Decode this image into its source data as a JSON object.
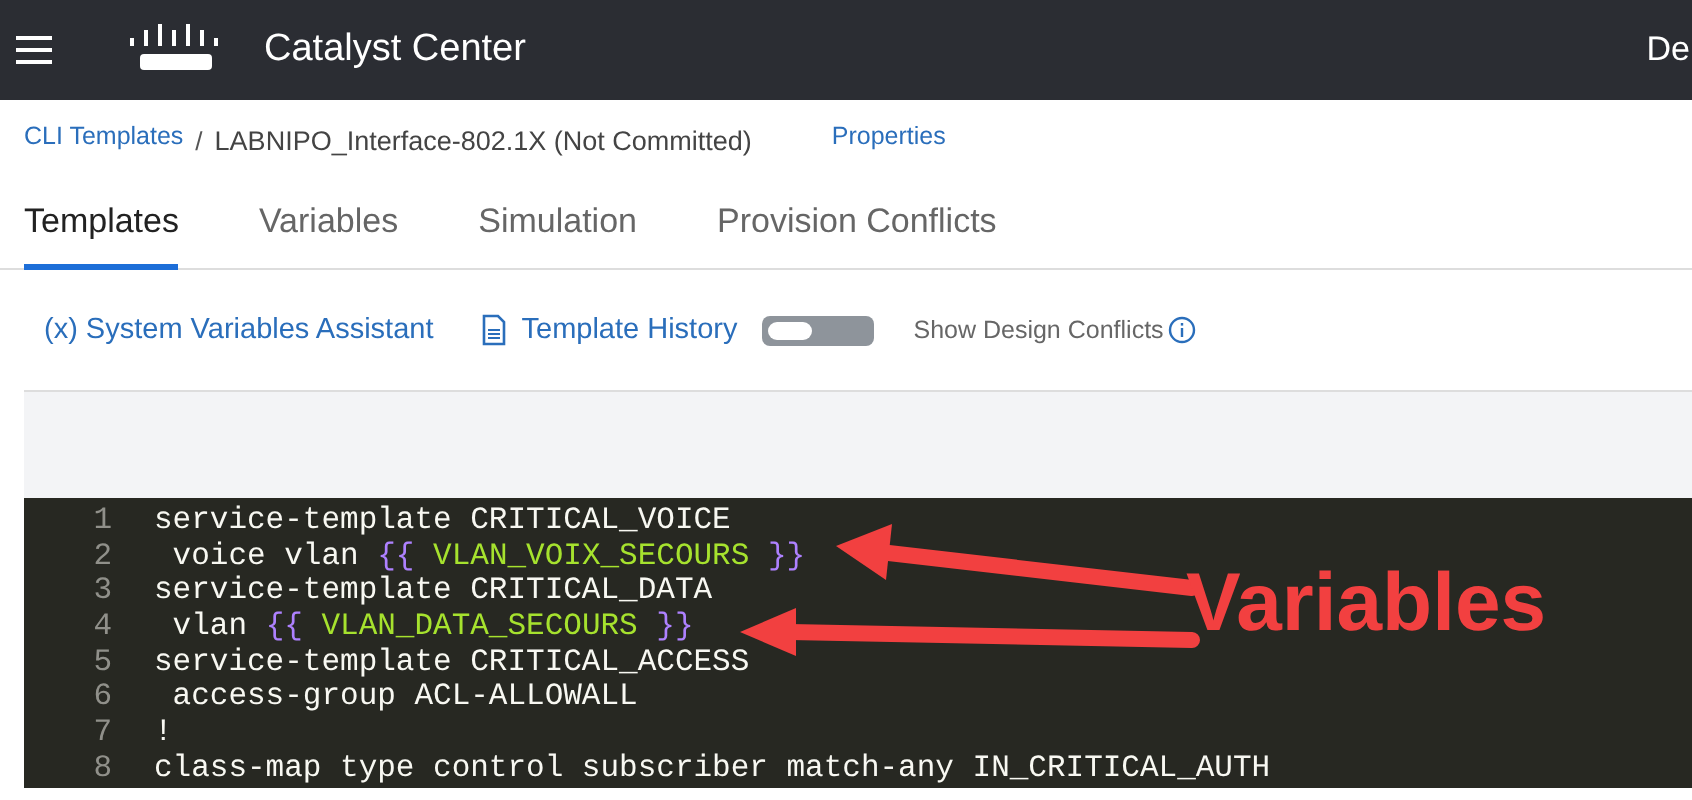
{
  "header": {
    "title": "Catalyst Center",
    "right_text": "De"
  },
  "breadcrumb": {
    "parent": "CLI Templates",
    "separator": "/",
    "current": "LABNIPO_Interface-802.1X (Not Committed)",
    "link": "Properties"
  },
  "tabs": [
    {
      "label": "Templates",
      "selected": true
    },
    {
      "label": "Variables",
      "selected": false
    },
    {
      "label": "Simulation",
      "selected": false
    },
    {
      "label": "Provision Conflicts",
      "selected": false
    }
  ],
  "toolbar": {
    "assistant": "(x) System Variables Assistant",
    "history": "Template History",
    "toggle": {
      "on": false,
      "label": "Show Design Conflicts"
    }
  },
  "editor": {
    "lines": [
      {
        "number": "1",
        "segments": [
          {
            "kind": "text",
            "text": "service-template CRITICAL_VOICE"
          }
        ]
      },
      {
        "number": "2",
        "segments": [
          {
            "kind": "text",
            "text": " voice vlan "
          },
          {
            "kind": "brace",
            "text": "{{"
          },
          {
            "kind": "var",
            "text": " VLAN_VOIX_SECOURS "
          },
          {
            "kind": "brace",
            "text": "}}"
          }
        ]
      },
      {
        "number": "3",
        "segments": [
          {
            "kind": "text",
            "text": "service-template CRITICAL_DATA"
          }
        ]
      },
      {
        "number": "4",
        "segments": [
          {
            "kind": "text",
            "text": " vlan "
          },
          {
            "kind": "brace",
            "text": "{{"
          },
          {
            "kind": "var",
            "text": " VLAN_DATA_SECOURS "
          },
          {
            "kind": "brace",
            "text": "}}"
          }
        ]
      },
      {
        "number": "5",
        "segments": [
          {
            "kind": "text",
            "text": "service-template CRITICAL_ACCESS"
          }
        ]
      },
      {
        "number": "6",
        "segments": [
          {
            "kind": "text",
            "text": " access-group ACL-ALLOWALL"
          }
        ]
      },
      {
        "number": "7",
        "segments": [
          {
            "kind": "text",
            "text": "!"
          }
        ]
      },
      {
        "number": "8",
        "segments": [
          {
            "kind": "text",
            "text": "class-map type control subscriber match-any IN_CRITICAL_AUTH"
          }
        ]
      }
    ]
  },
  "annotation": {
    "label": "Variables"
  }
}
